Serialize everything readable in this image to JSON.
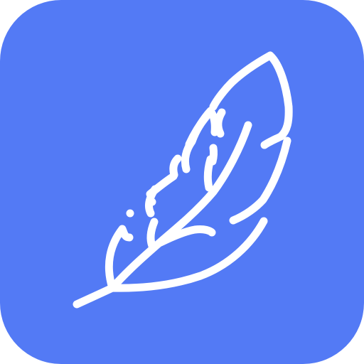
{
  "app_icon": {
    "icon": "feather-icon",
    "background_color": "#537AF5",
    "stroke_color": "#FFFFFF"
  }
}
